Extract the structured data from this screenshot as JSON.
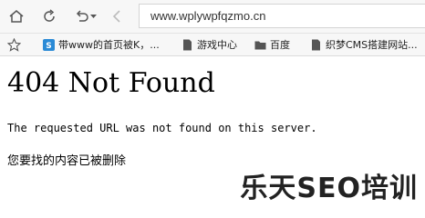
{
  "browser": {
    "url": "www.wplywpfqzmo.cn"
  },
  "bookmarks": [
    {
      "label": "带www的首页被K，...",
      "icon": "site-favicon"
    },
    {
      "label": "游戏中心",
      "icon": "page-icon"
    },
    {
      "label": "百度",
      "icon": "folder-icon"
    },
    {
      "label": "织梦CMS搭建网站...",
      "icon": "page-icon"
    }
  ],
  "page": {
    "title": "404 Not Found",
    "message": "The requested URL was not found on this server.",
    "message_cn": "您要找的内容已被删除"
  },
  "watermark": "乐天SEO培训"
}
